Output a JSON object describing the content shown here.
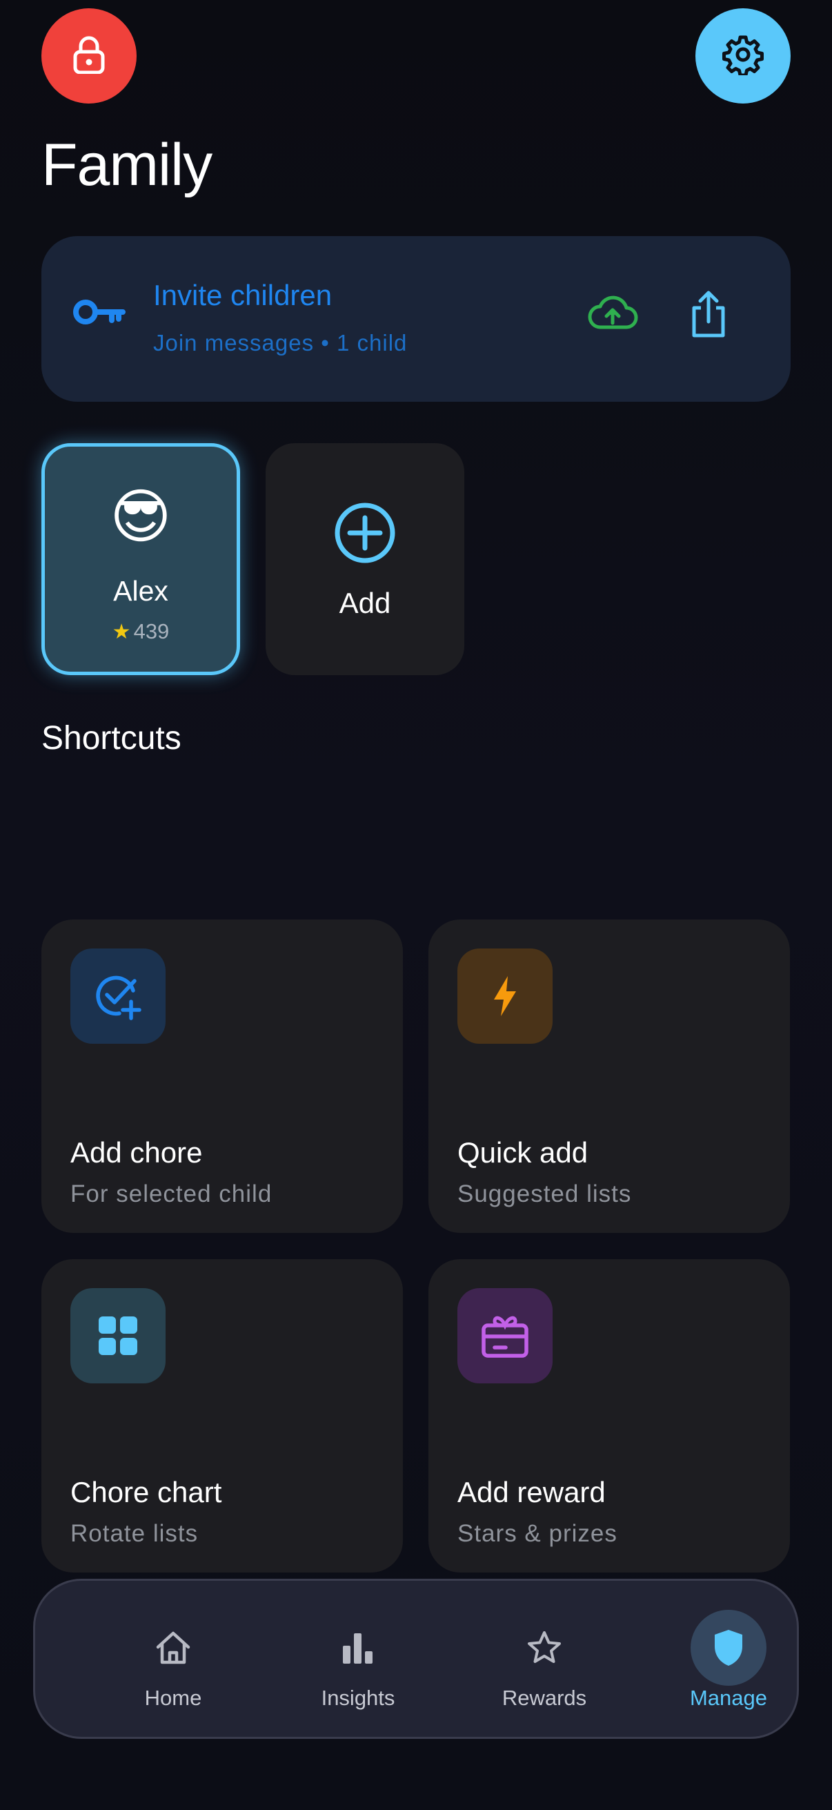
{
  "header": {
    "lock_icon": "lock-icon",
    "settings_icon": "gear-icon",
    "title": "Family"
  },
  "invite": {
    "title": "Invite children",
    "subtitle": "Join messages • 1 child",
    "icons": [
      "key-icon",
      "cloud-upload-icon",
      "share-icon"
    ],
    "colors": {
      "title": "#1f86f0",
      "upload": "#2fb04f",
      "share": "#5ac8fa"
    }
  },
  "children": [
    {
      "emoji": "😎",
      "name": "Alex",
      "stars": "439",
      "selected": true
    }
  ],
  "add_child": {
    "label": "Add",
    "icon": "plus-circle-icon"
  },
  "shortcuts": {
    "title": "Shortcuts",
    "tiles": [
      {
        "title": "Add chore",
        "subtitle": "For selected child",
        "icon": "check-plus-icon",
        "color": "#1f86f0"
      },
      {
        "title": "Quick add",
        "subtitle": "Suggested lists",
        "icon": "bolt-icon",
        "color": "#f79a0d"
      },
      {
        "title": "Chore chart",
        "subtitle": "Rotate lists",
        "icon": "grid-icon",
        "color": "#5ac8fa"
      },
      {
        "title": "Add reward",
        "subtitle": "Stars & prizes",
        "icon": "gift-card-icon",
        "color": "#c260e8"
      }
    ]
  },
  "tabs": [
    {
      "label": "Home",
      "icon": "home-icon",
      "active": false
    },
    {
      "label": "Insights",
      "icon": "bar-chart-icon",
      "active": false
    },
    {
      "label": "Rewards",
      "icon": "star-icon",
      "active": false
    },
    {
      "label": "Manage",
      "icon": "shield-icon",
      "active": true
    }
  ]
}
